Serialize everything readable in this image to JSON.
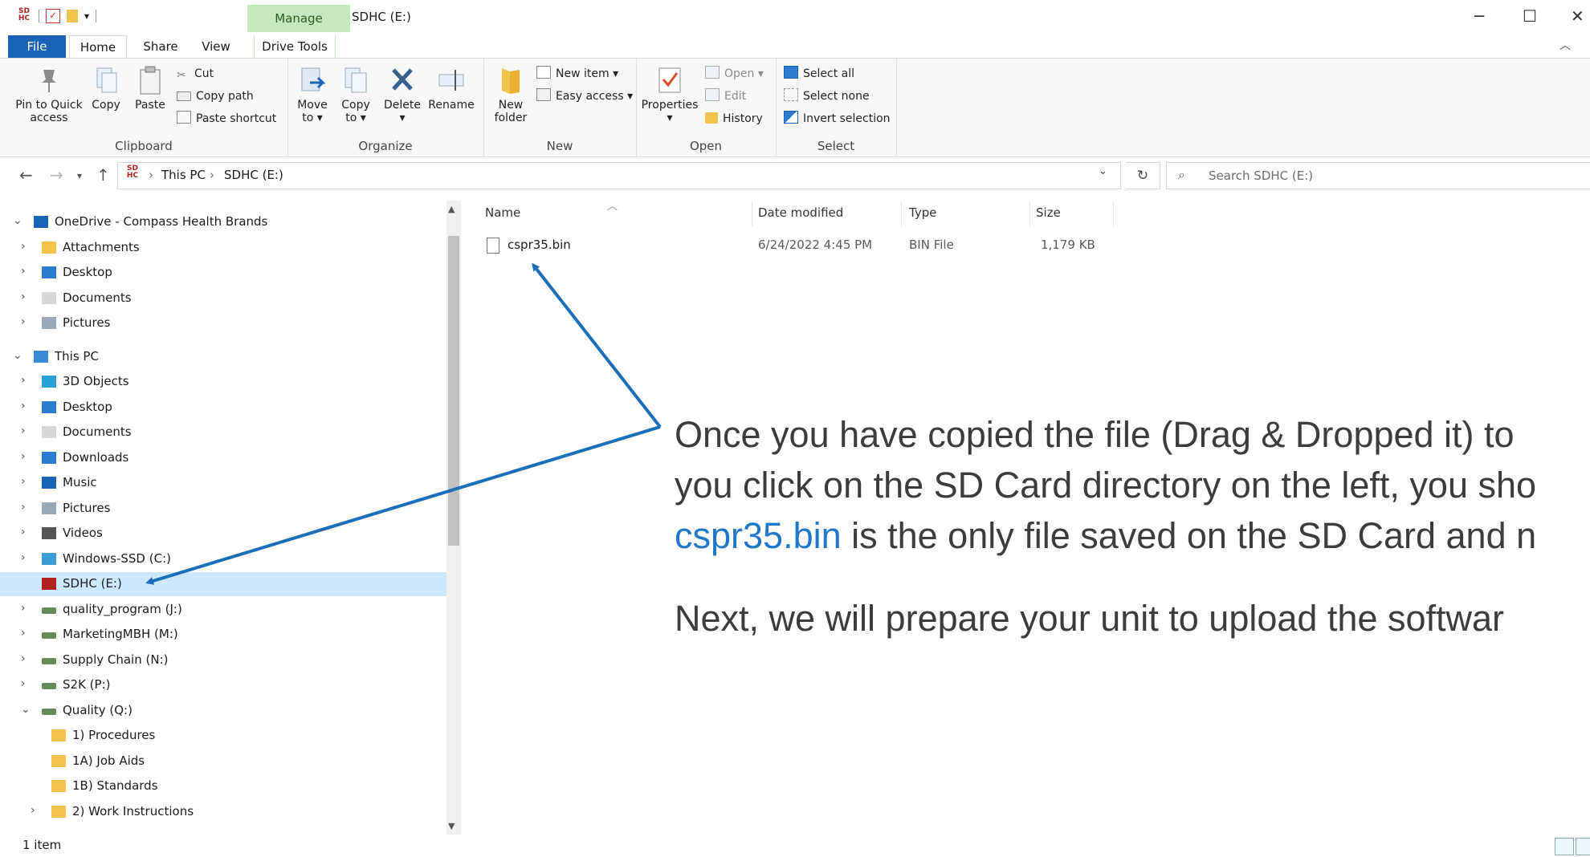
{
  "window": {
    "title": "SDHC (E:)",
    "manage_label": "Manage",
    "drive_icon_text": "SD HC"
  },
  "ribbon_tabs": {
    "file": "File",
    "home": "Home",
    "share": "Share",
    "view": "View",
    "drive_tools": "Drive Tools"
  },
  "clipboard": {
    "label": "Clipboard",
    "pin_line1": "Pin to Quick",
    "pin_line2": "access",
    "copy": "Copy",
    "paste": "Paste",
    "cut": "Cut",
    "copy_path": "Copy path",
    "paste_shortcut": "Paste shortcut"
  },
  "organize": {
    "label": "Organize",
    "move_line1": "Move",
    "move_line2": "to",
    "copy_line1": "Copy",
    "copy_line2": "to",
    "delete": "Delete",
    "rename": "Rename"
  },
  "new_group": {
    "label": "New",
    "new_folder_line1": "New",
    "new_folder_line2": "folder",
    "new_item": "New item",
    "easy_access": "Easy access"
  },
  "open_group": {
    "label": "Open",
    "properties": "Properties",
    "open": "Open",
    "edit": "Edit",
    "history": "History"
  },
  "select_group": {
    "label": "Select",
    "select_all": "Select all",
    "select_none": "Select none",
    "invert": "Invert selection"
  },
  "address": {
    "crumbs": [
      "This PC",
      "SDHC (E:)"
    ],
    "search_placeholder": "Search SDHC (E:)"
  },
  "nav_tree": [
    {
      "label": "OneDrive - Compass Health Brands",
      "chevron": "expanded"
    },
    {
      "label": "Attachments",
      "chevron": "collapsed"
    },
    {
      "label": "Desktop",
      "chevron": "collapsed"
    },
    {
      "label": "Documents",
      "chevron": "collapsed"
    },
    {
      "label": "Pictures",
      "chevron": "collapsed"
    },
    {
      "label": "This PC",
      "chevron": "expanded"
    },
    {
      "label": "3D Objects",
      "chevron": "collapsed"
    },
    {
      "label": "Desktop",
      "chevron": "collapsed"
    },
    {
      "label": "Documents",
      "chevron": "collapsed"
    },
    {
      "label": "Downloads",
      "chevron": "collapsed"
    },
    {
      "label": "Music",
      "chevron": "collapsed"
    },
    {
      "label": "Pictures",
      "chevron": "collapsed"
    },
    {
      "label": "Videos",
      "chevron": "collapsed"
    },
    {
      "label": "Windows-SSD (C:)",
      "chevron": "collapsed"
    },
    {
      "label": "SDHC (E:)",
      "chevron": "none",
      "selected": true
    },
    {
      "label": "quality_program (J:)",
      "chevron": "collapsed"
    },
    {
      "label": "MarketingMBH (M:)",
      "chevron": "collapsed"
    },
    {
      "label": "Supply Chain (N:)",
      "chevron": "collapsed"
    },
    {
      "label": "S2K (P:)",
      "chevron": "collapsed"
    },
    {
      "label": "Quality (Q:)",
      "chevron": "expanded"
    },
    {
      "label": "1) Procedures",
      "chevron": "none"
    },
    {
      "label": "1A) Job Aids",
      "chevron": "none"
    },
    {
      "label": "1B) Standards",
      "chevron": "none"
    },
    {
      "label": "2) Work Instructions",
      "chevron": "collapsed"
    }
  ],
  "columns": {
    "name": "Name",
    "date": "Date modified",
    "type": "Type",
    "size": "Size"
  },
  "files": [
    {
      "name": "cspr35.bin",
      "date": "6/24/2022 4:45 PM",
      "type": "BIN File",
      "size": "1,179 KB"
    }
  ],
  "annotation": {
    "line1": "Once you have copied the file (Drag & Dropped it) to",
    "line2": "you click on the SD Card directory on the left, you sho",
    "line3_highlight": "cspr35.bin",
    "line3_rest": " is the only file saved on the SD Card and n",
    "line4": "Next, we will prepare your unit to upload the softwar"
  },
  "status": {
    "item_count": "1 item"
  },
  "colors": {
    "file_tab": "#1a64b5",
    "manage_tab": "#c6e8bf",
    "selection": "#cce8ff",
    "annotation_highlight": "#1f77c9",
    "arrow": "#1a6fb7"
  }
}
